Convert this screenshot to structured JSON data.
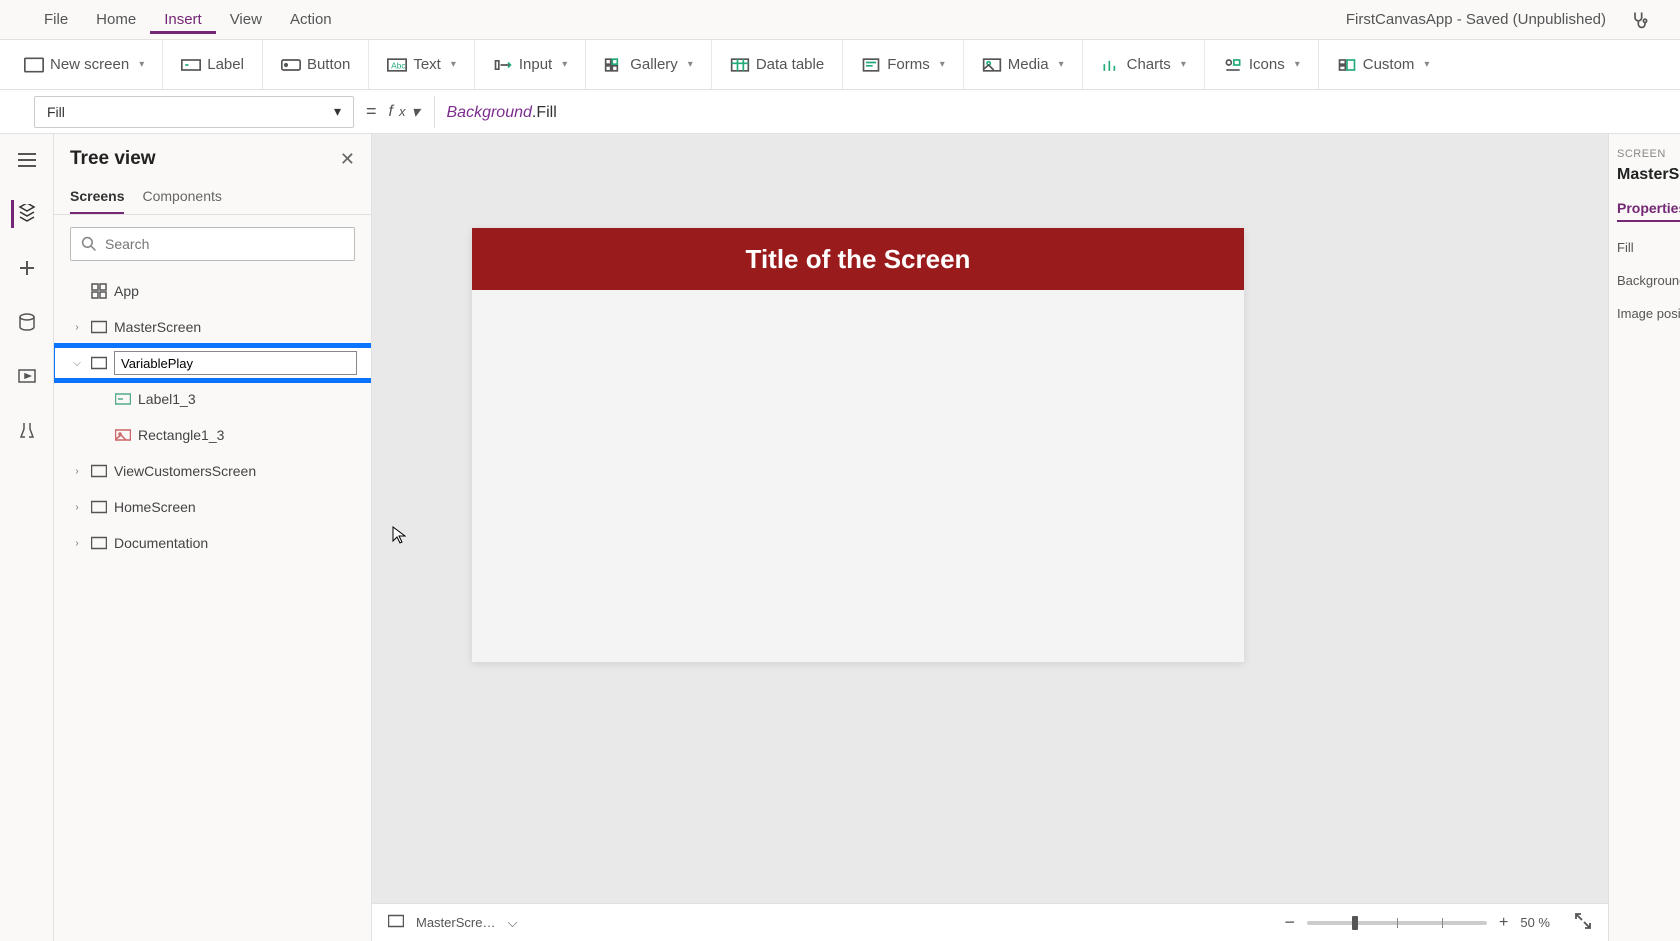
{
  "menubar": {
    "items": [
      "File",
      "Home",
      "Insert",
      "View",
      "Action"
    ],
    "active_index": 2,
    "app_title": "FirstCanvasApp - Saved (Unpublished)"
  },
  "ribbon": {
    "new_screen": "New screen",
    "label": "Label",
    "button": "Button",
    "text": "Text",
    "input": "Input",
    "gallery": "Gallery",
    "data_table": "Data table",
    "forms": "Forms",
    "media": "Media",
    "charts": "Charts",
    "icons": "Icons",
    "custom": "Custom"
  },
  "formula": {
    "property": "Fill",
    "ref": "Background",
    "prop": "Fill"
  },
  "tree": {
    "title": "Tree view",
    "tabs": {
      "screens": "Screens",
      "components": "Components"
    },
    "search_placeholder": "Search",
    "app_label": "App",
    "nodes": {
      "master": "MasterScreen",
      "rename_value": "VariablePlay",
      "label_child": "Label1_3",
      "rect_child": "Rectangle1_3",
      "view_customers": "ViewCustomersScreen",
      "home": "HomeScreen",
      "documentation": "Documentation"
    }
  },
  "canvas": {
    "banner_text": "Title of the Screen"
  },
  "statusbar": {
    "screen_name": "MasterScre…",
    "zoom_value": "50 %"
  },
  "rightpanel": {
    "category": "SCREEN",
    "object": "MasterScre",
    "tab": "Properties",
    "rows": {
      "fill": "Fill",
      "bg": "Background",
      "imgpos": "Image posit"
    }
  }
}
